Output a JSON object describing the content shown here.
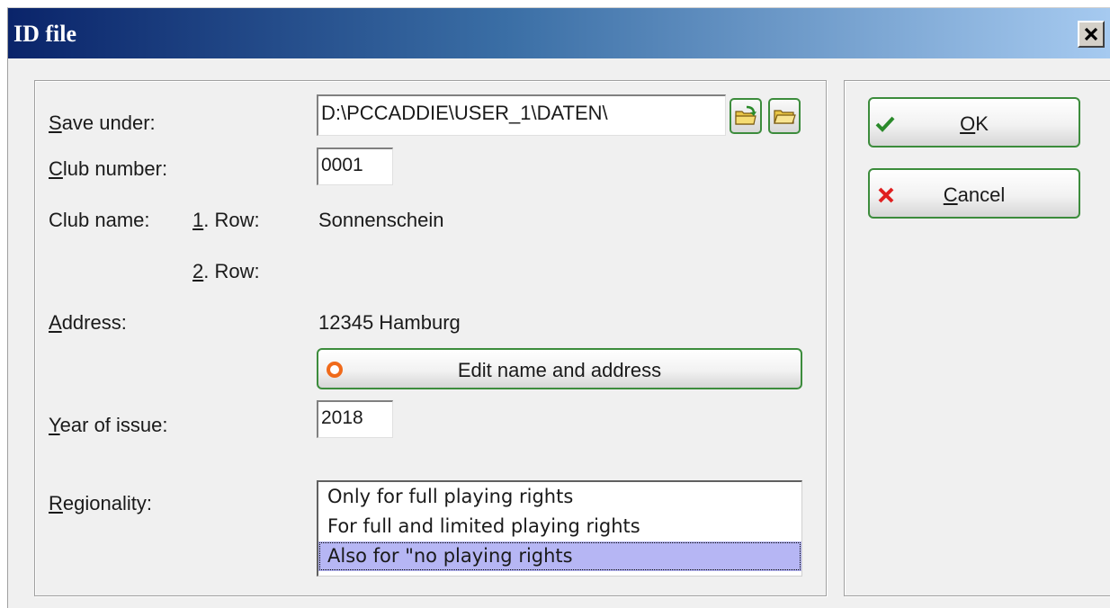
{
  "window": {
    "title": "ID file"
  },
  "form": {
    "save_under": {
      "label_u": "S",
      "label_rest": "ave under:",
      "value": "D:\\PCCADDIE\\USER_1\\DATEN\\"
    },
    "club_number": {
      "label_u": "C",
      "label_rest": "lub number:",
      "value": "0001"
    },
    "club_name": {
      "label": "Club name:",
      "row1_u": "1",
      "row1_rest": ". Row:",
      "row1_value": "Sonnenschein",
      "row2_u": "2",
      "row2_rest": ". Row:",
      "row2_value": ""
    },
    "address": {
      "label_u": "A",
      "label_rest": "ddress:",
      "value": "12345 Hamburg"
    },
    "edit_button_label": "Edit name and address",
    "year": {
      "label_u": "Y",
      "label_rest": "ear of issue:",
      "value": "2018"
    },
    "regionality": {
      "label_u": "R",
      "label_rest": "egionality:",
      "options": [
        "Only for full playing rights",
        "For full and limited playing rights",
        "Also for \"no playing rights"
      ],
      "selected_index": 2
    }
  },
  "buttons": {
    "ok_u": "O",
    "ok_rest": "K",
    "cancel_u": "C",
    "cancel_rest": "ancel"
  },
  "colors": {
    "button_border": "#3c8c3c",
    "selection": "#b6b6f4",
    "title_gradient_start": "#0a246a"
  },
  "icons": {
    "save_browse": "folder-arrow-icon",
    "save_open": "folder-icon",
    "ok": "check-icon",
    "cancel": "x-icon",
    "edit": "radio-ring-icon",
    "close": "close-icon"
  }
}
